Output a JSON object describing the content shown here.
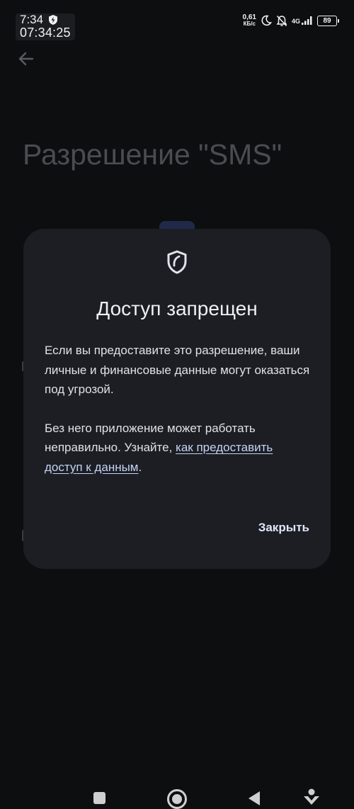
{
  "status_bar": {
    "time": "7:34",
    "clock": "07:34:25",
    "net_speed_value": "0,61",
    "net_speed_unit": "КБ/с",
    "network_type": "4G",
    "battery": "89",
    "icons": [
      "shield-bolt-icon",
      "moon-icon",
      "bell-off-icon",
      "signal-icon",
      "battery-icon"
    ]
  },
  "page": {
    "title": "Разрешение \"SMS\""
  },
  "dialog": {
    "icon": "shield-icon",
    "title": "Доступ запрещен",
    "body_1": "Если вы предоставите это разрешение, ваши личные и финансовые данные могут оказаться под угрозой.",
    "body_2_prefix": "Без него приложение может работать неправильно. Узнайте, ",
    "body_2_link": "как предоставить доступ к данным",
    "body_2_suffix": ".",
    "close_label": "Закрыть"
  },
  "nav_bar": {
    "icons": [
      "recents-icon",
      "home-icon",
      "back-icon",
      "assistant-icon"
    ]
  },
  "colors": {
    "background": "#0d0e10",
    "dialog_bg": "#1c1e23",
    "title_dim": "#4b4c50",
    "link": "#c4d3f5",
    "accent_chip": "#1f2a4a"
  }
}
